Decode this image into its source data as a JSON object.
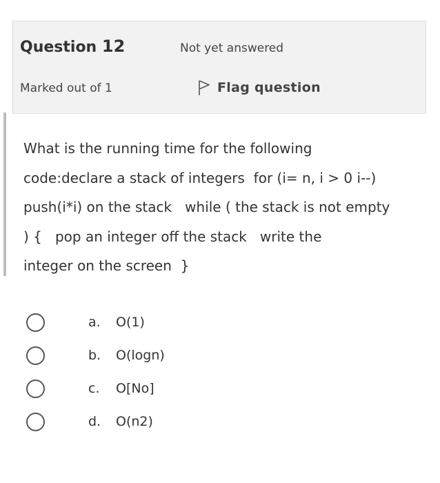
{
  "info": {
    "title_prefix": "Question",
    "number": "12",
    "state": "Not yet answered",
    "grade": "Marked out of 1",
    "flag_label": "Flag question",
    "flag_icon": "flag-outline-icon"
  },
  "question": {
    "text": "What is the running time for the following\ncode:declare a stack of integers  for (i= n, i > 0 i--)\npush(i*i) on the stack   while ( the stack is not empty\n) {   pop an integer off the stack   write the\ninteger on the screen  }"
  },
  "answers": [
    {
      "letter": "a.",
      "text": "O(1)"
    },
    {
      "letter": "b.",
      "text": "O(logn)"
    },
    {
      "letter": "c.",
      "text": "O[No]"
    },
    {
      "letter": "d.",
      "text": "O(n2)"
    }
  ]
}
